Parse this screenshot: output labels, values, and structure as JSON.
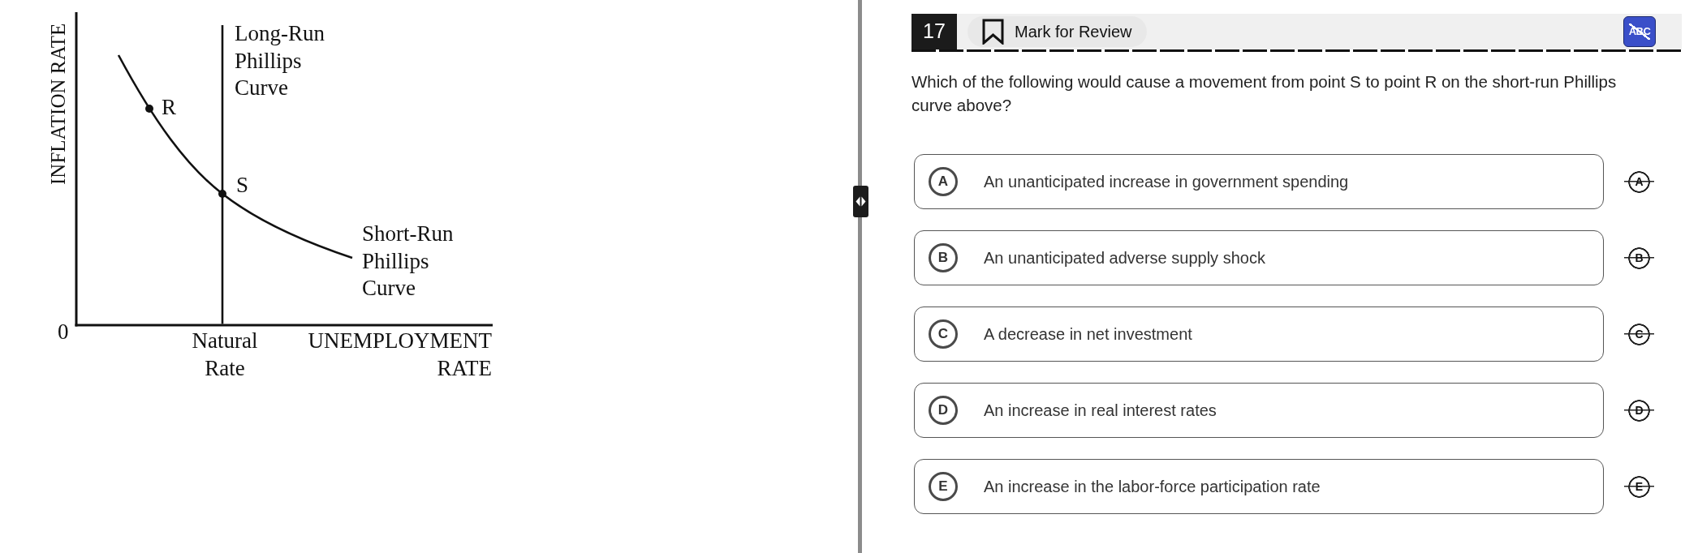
{
  "graph": {
    "y_axis_label": "INFLATION RATE",
    "long_run_curve_label": [
      "Long-Run",
      "Phillips",
      "Curve"
    ],
    "points": [
      {
        "label": "R"
      },
      {
        "label": "S"
      }
    ],
    "short_run_curve_label": [
      "Short-Run",
      "Phillips",
      "Curve"
    ],
    "origin_label": "0",
    "x_tick_label": [
      "Natural",
      "Rate"
    ],
    "x_axis_label": [
      "UNEMPLOYMENT",
      "RATE"
    ]
  },
  "header": {
    "question_number": "17",
    "mark_for_review": {
      "label": "Mark for Review",
      "marked": false
    },
    "answer_eliminator": {
      "label": "ABC",
      "on": true
    }
  },
  "question": "Which of the following would cause a movement from point S to point R on the short-run Phillips curve above?",
  "options": [
    {
      "letter": "A",
      "text": "An unanticipated increase in government spending",
      "selected": false,
      "eliminator_letter": "A"
    },
    {
      "letter": "B",
      "text": "An unanticipated adverse supply shock",
      "selected": false,
      "eliminator_letter": "B"
    },
    {
      "letter": "C",
      "text": "A decrease in net investment",
      "selected": false,
      "eliminator_letter": "C"
    },
    {
      "letter": "D",
      "text": "An increase in real interest rates",
      "selected": false,
      "eliminator_letter": "D"
    },
    {
      "letter": "E",
      "text": "An increase in the labor-force participation rate",
      "selected": false,
      "eliminator_letter": "E"
    }
  ]
}
